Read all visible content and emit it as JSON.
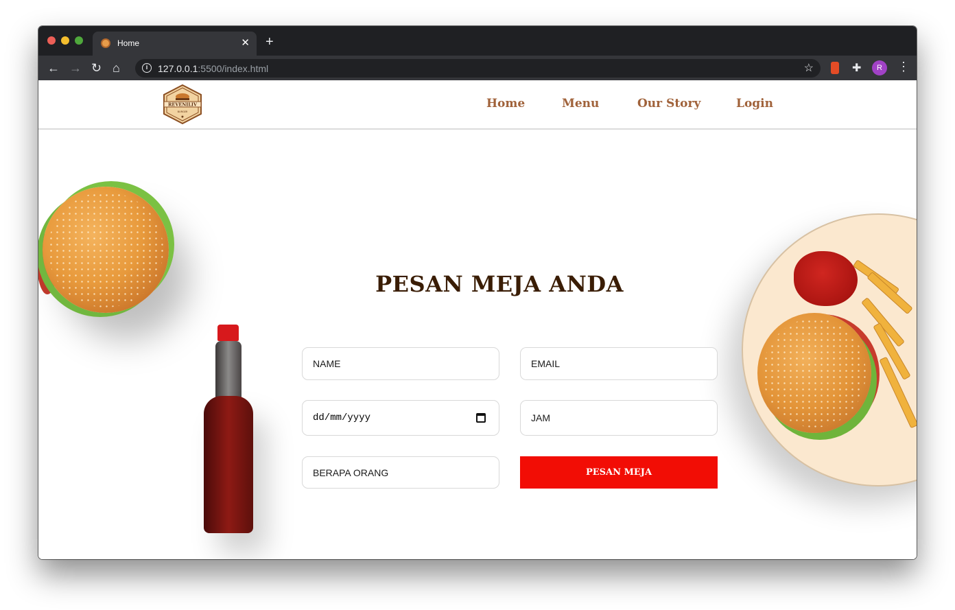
{
  "browser": {
    "tab_title": "Home",
    "tab_close": "✕",
    "new_tab": "+",
    "url_host": "127.0.0.1",
    "url_rest": ":5500/index.html",
    "avatar_letter": "R"
  },
  "nav": {
    "logo_text": "REVENILIV",
    "logo_subtext": "BURGER",
    "links": [
      {
        "label": "Home"
      },
      {
        "label": "Menu"
      },
      {
        "label": "Our Story"
      },
      {
        "label": "Login"
      }
    ],
    "link_color": "#a0623a"
  },
  "reservation": {
    "title": "PESAN MEJA ANDA",
    "name_placeholder": "NAME",
    "email_placeholder": "EMAIL",
    "date_placeholder": "dd/mm/yyyy",
    "time_placeholder": "JAM",
    "people_placeholder": "BERAPA ORANG",
    "submit_label": "PESAN MEJA",
    "accent_color": "#f20d05",
    "title_color": "#3a1d05"
  }
}
